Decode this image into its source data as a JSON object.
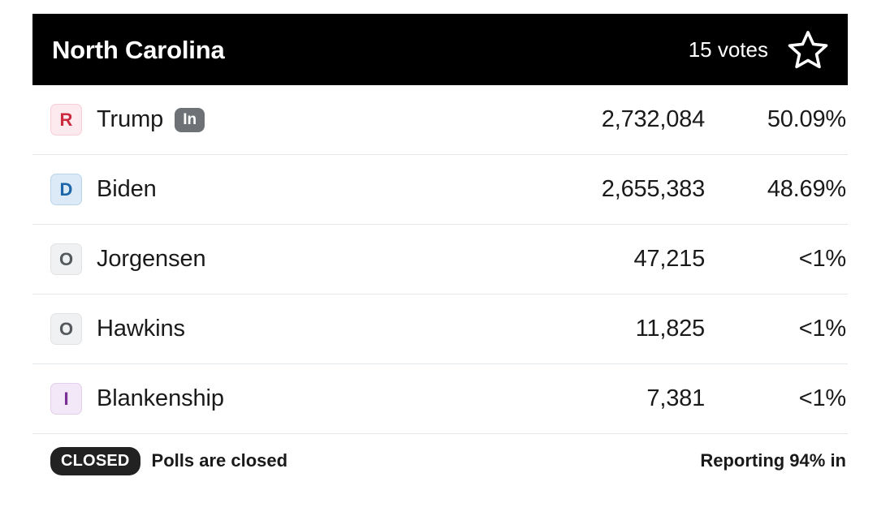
{
  "header": {
    "state": "North Carolina",
    "votes_label": "15 votes",
    "star_icon": "star-outline-icon"
  },
  "results": [
    {
      "party_letter": "R",
      "party_class": "badge-R",
      "name": "Trump",
      "incumbent_label": "In",
      "votes": "2,732,084",
      "percent": "50.09%"
    },
    {
      "party_letter": "D",
      "party_class": "badge-D",
      "name": "Biden",
      "incumbent_label": "",
      "votes": "2,655,383",
      "percent": "48.69%"
    },
    {
      "party_letter": "O",
      "party_class": "badge-O",
      "name": "Jorgensen",
      "incumbent_label": "",
      "votes": "47,215",
      "percent": "<1%"
    },
    {
      "party_letter": "O",
      "party_class": "badge-O",
      "name": "Hawkins",
      "incumbent_label": "",
      "votes": "11,825",
      "percent": "<1%"
    },
    {
      "party_letter": "I",
      "party_class": "badge-I",
      "name": "Blankenship",
      "incumbent_label": "",
      "votes": "7,381",
      "percent": "<1%"
    }
  ],
  "footer": {
    "closed_badge": "CLOSED",
    "polls_status": "Polls are closed",
    "reporting": "Reporting 94% in"
  },
  "colors": {
    "header_bg": "#000000",
    "republican": "#cb2b3e",
    "democrat": "#1b65a8",
    "other": "#55595d",
    "independent": "#7b2f96",
    "divider": "#e3e8ec"
  }
}
